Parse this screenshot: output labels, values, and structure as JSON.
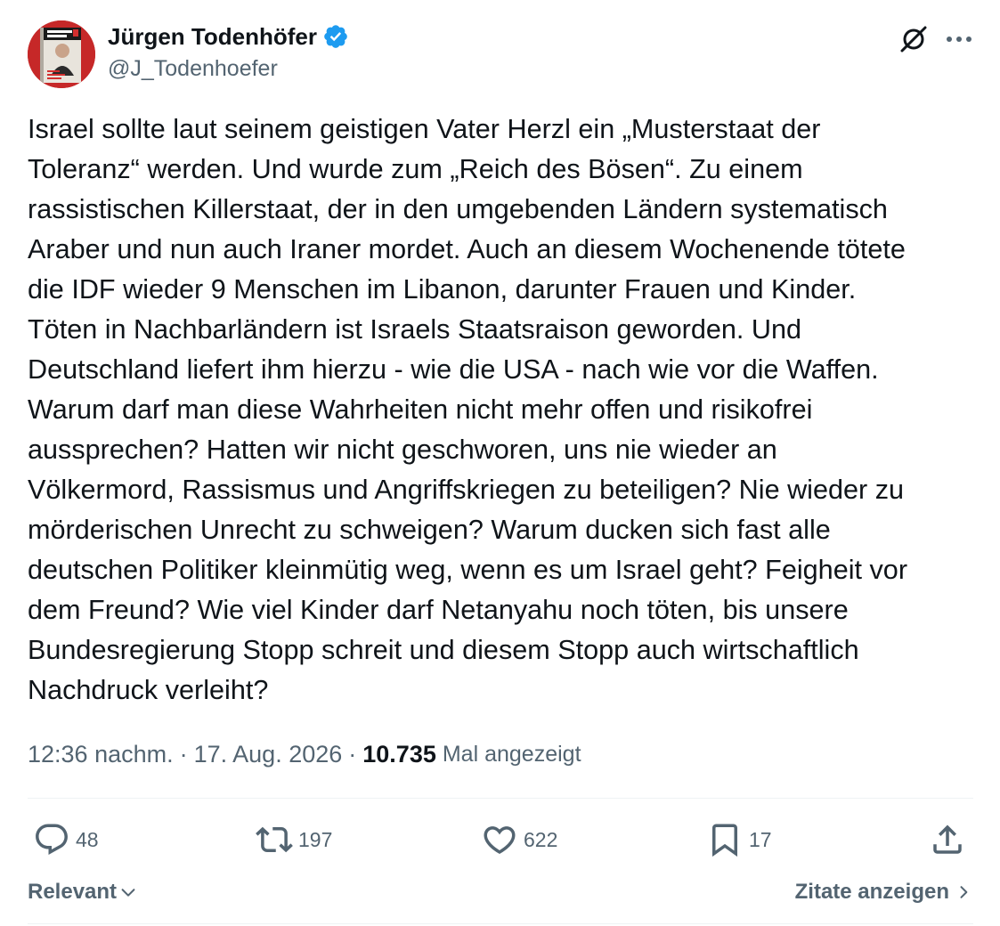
{
  "author": {
    "display_name": "Jürgen Todenhöfer",
    "handle": "@J_Todenhoefer",
    "verified": true,
    "avatar_book_title": "JÜRGEN TODENHÖFER"
  },
  "header": {
    "grok_icon": "grok-icon",
    "more_icon": "more-icon"
  },
  "tweet": {
    "text": "Israel sollte laut seinem geistigen Vater Herzl ein „Musterstaat der\nToleranz“ werden. Und wurde zum „Reich des Bösen“. Zu einem\nrassistischen Killerstaat, der in den umgebenden Ländern systematisch\nAraber und nun auch Iraner mordet. Auch an diesem Wochenende tötete\ndie IDF wieder 9 Menschen im Libanon, darunter Frauen und Kinder.\nTöten in Nachbarländern ist Israels Staatsraison geworden. Und\nDeutschland liefert ihm hierzu - wie die USA - nach wie vor die Waffen.\nWarum darf man diese Wahrheiten nicht mehr offen und risikofrei\naussprechen? Hatten wir nicht geschworen, uns nie wieder an\nVölkermord, Rassismus und Angriffskriegen zu beteiligen? Nie wieder zu\nmörderischen Unrecht zu schweigen? Warum ducken sich fast alle\ndeutschen Politiker kleinmütig weg, wenn es um Israel geht? Feigheit vor\ndem Freund? Wie viel Kinder darf Netanyahu noch töten, bis unsere\nBundesregierung Stopp schreit und diesem Stopp auch wirtschaftlich\nNachdruck verleiht?"
  },
  "meta": {
    "time": "12:36 nachm.",
    "separator": "·",
    "date": "17. Aug. 2026",
    "views_count": "10.735",
    "views_label": "Mal angezeigt"
  },
  "actions": {
    "replies": "48",
    "reposts": "197",
    "likes": "622",
    "bookmarks": "17"
  },
  "footer": {
    "sort_label": "Relevant",
    "quotes_label": "Zitate anzeigen"
  },
  "colors": {
    "text_primary": "#0f1419",
    "text_secondary": "#536471",
    "verified_blue": "#1d9bf0",
    "divider": "#eff3f4"
  }
}
